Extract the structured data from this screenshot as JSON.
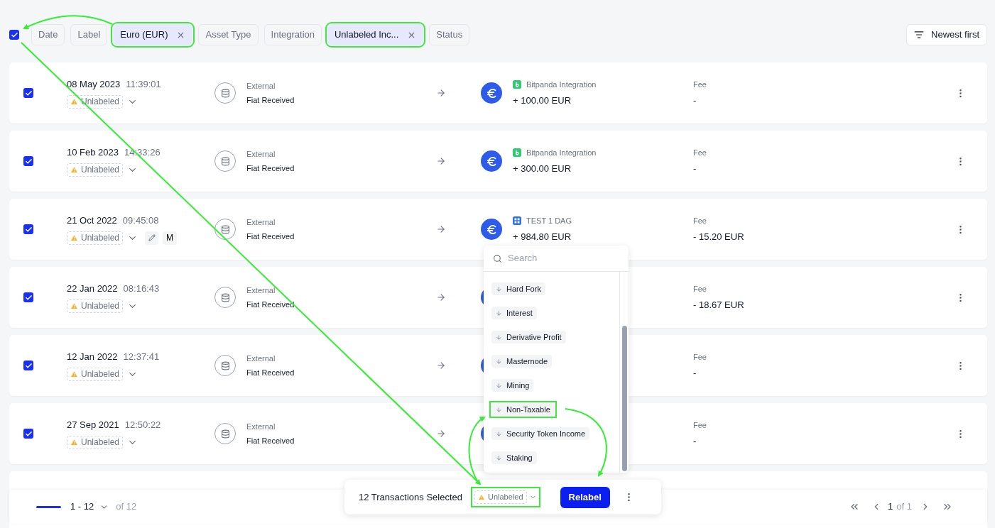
{
  "filter_bar": {
    "select_all": {
      "checked": true
    },
    "chips": [
      {
        "label": "Date",
        "active": false,
        "highlighted": false
      },
      {
        "label": "Label",
        "active": false,
        "highlighted": false
      },
      {
        "label": "Euro (EUR)",
        "active": true,
        "highlighted": true
      },
      {
        "label": "Asset Type",
        "active": false,
        "highlighted": false
      },
      {
        "label": "Integration",
        "active": false,
        "highlighted": false
      },
      {
        "label": "Unlabeled Inc...",
        "active": true,
        "highlighted": true
      },
      {
        "label": "Status",
        "active": false,
        "highlighted": false
      }
    ],
    "sort": {
      "label": "Newest first"
    }
  },
  "rows": [
    {
      "checked": true,
      "date": "08 May 2023",
      "time": "11:39:01",
      "label": "Unlabeled",
      "source": "External",
      "type": "Fiat Received",
      "integration": {
        "kind": "bitpanda",
        "name": "Bitpanda Integration"
      },
      "amount": "+ 100.00 EUR",
      "fee_label": "Fee",
      "fee": "-"
    },
    {
      "checked": true,
      "date": "10 Feb 2023",
      "time": "14:33:26",
      "label": "Unlabeled",
      "source": "External",
      "type": "Fiat Received",
      "integration": {
        "kind": "bitpanda",
        "name": "Bitpanda Integration"
      },
      "amount": "+ 300.00 EUR",
      "fee_label": "Fee",
      "fee": "-"
    },
    {
      "checked": true,
      "date": "21 Oct 2022",
      "time": "09:45:08",
      "label": "Unlabeled",
      "has_edit": true,
      "tag": "M",
      "source": "External",
      "type": "Fiat Received",
      "integration": {
        "kind": "grid",
        "name": "TEST 1 DAG"
      },
      "amount": "+ 984.80 EUR",
      "fee_label": "Fee",
      "fee": "- 15.20 EUR"
    },
    {
      "checked": true,
      "date": "22 Jan 2022",
      "time": "08:16:43",
      "label": "Unlabeled",
      "source": "External",
      "type": "Fiat Received",
      "fee_label": "Fee",
      "fee": "- 18.67 EUR"
    },
    {
      "checked": true,
      "date": "12 Jan 2022",
      "time": "12:37:41",
      "label": "Unlabeled",
      "source": "External",
      "type": "Fiat Received",
      "fee_label": "Fee",
      "fee": "-"
    },
    {
      "checked": true,
      "date": "27 Sep 2021",
      "time": "12:50:22",
      "label": "Unlabeled",
      "source": "External",
      "type": "Fiat Received",
      "fee_label": "Fee",
      "fee": "-"
    }
  ],
  "label_dropdown": {
    "search": {
      "placeholder": "Search"
    },
    "items": [
      {
        "label": "Hard Fork",
        "highlighted": false
      },
      {
        "label": "Interest",
        "highlighted": false
      },
      {
        "label": "Derivative Profit",
        "highlighted": false
      },
      {
        "label": "Masternode",
        "highlighted": false
      },
      {
        "label": "Mining",
        "highlighted": false
      },
      {
        "label": "Non-Taxable",
        "highlighted": true
      },
      {
        "label": "Security Token Income",
        "highlighted": false
      },
      {
        "label": "Staking",
        "highlighted": false
      }
    ]
  },
  "bulk_bar": {
    "count_text": "12 Transactions Selected",
    "label": {
      "text": "Unlabeled",
      "highlighted": true
    },
    "action": "Relabel"
  },
  "footer": {
    "range": "1 - 12",
    "total": "of 12",
    "page": "1",
    "page_total": "of 1"
  }
}
